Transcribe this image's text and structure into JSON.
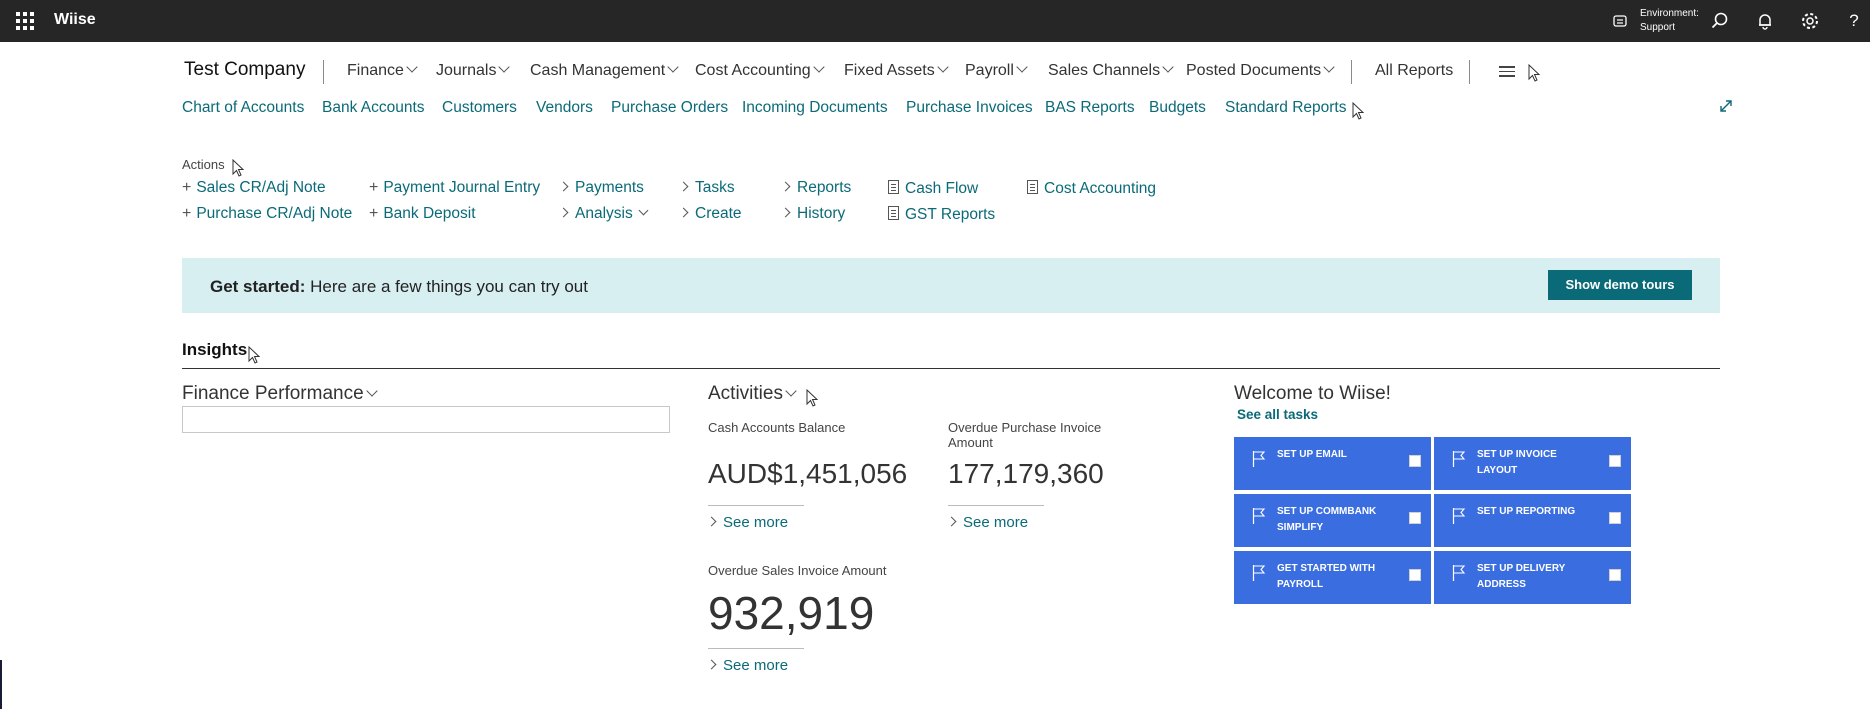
{
  "app": {
    "brand": "Wiise",
    "environment_label": "Environment:",
    "environment_value": "Support"
  },
  "header": {
    "company": "Test Company",
    "menus": [
      "Finance",
      "Journals",
      "Cash Management",
      "Cost Accounting",
      "Fixed Assets",
      "Payroll",
      "Sales Channels",
      "Posted Documents"
    ],
    "all_reports": "All Reports"
  },
  "nav_links": [
    "Chart of Accounts",
    "Bank Accounts",
    "Customers",
    "Vendors",
    "Purchase Orders",
    "Incoming Documents",
    "Purchase Invoices",
    "BAS Reports",
    "Budgets",
    "Standard Reports"
  ],
  "actions": {
    "title": "Actions",
    "items": [
      "Sales CR/Adj Note",
      "Purchase CR/Adj Note",
      "Payment Journal Entry",
      "Bank Deposit",
      "Payments",
      "Analysis",
      "Tasks",
      "Create",
      "Reports",
      "History",
      "Cash Flow",
      "GST Reports",
      "Cost Accounting"
    ]
  },
  "banner": {
    "bold": "Get started:",
    "text": " Here are a few things you can try out",
    "button": "Show demo tours"
  },
  "insights": {
    "title": "Insights"
  },
  "finance_performance": {
    "title": "Finance Performance"
  },
  "activities": {
    "title": "Activities",
    "tiles": [
      {
        "label": "Cash Accounts Balance",
        "value": "AUD$1,451,056",
        "link": "See more"
      },
      {
        "label": "Overdue Purchase Invoice Amount",
        "value": "177,179,360",
        "link": "See more"
      },
      {
        "label": "Overdue Sales Invoice Amount",
        "value": "932,919",
        "link": "See more"
      }
    ]
  },
  "welcome": {
    "title": "Welcome to Wiise!",
    "see_all": "See all tasks",
    "tasks": [
      "SET UP EMAIL",
      "SET UP INVOICE LAYOUT",
      "SET UP COMMBANK SIMPLIFY",
      "SET UP REPORTING",
      "GET STARTED WITH PAYROLL",
      "SET UP DELIVERY ADDRESS"
    ]
  },
  "colors": {
    "topbar": "#262626",
    "link": "#0b6a78",
    "banner": "#d8eff1",
    "tile": "#3a6ee0"
  }
}
